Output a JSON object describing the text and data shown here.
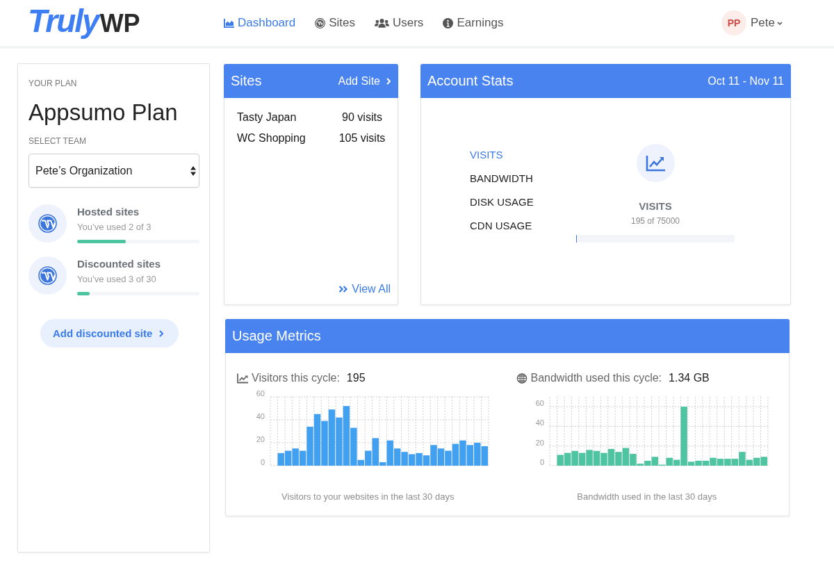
{
  "header": {
    "logo": [
      "Truly",
      "WP"
    ],
    "nav": [
      {
        "label": "Dashboard",
        "selected": true
      },
      {
        "label": "Sites",
        "selected": false
      },
      {
        "label": "Users",
        "selected": false
      },
      {
        "label": "Earnings",
        "selected": false
      }
    ],
    "user": {
      "initials": "PP",
      "name": "Pete"
    }
  },
  "plan_panel": {
    "eyebrow": "YOUR PLAN",
    "plan_name": "Appsumo Plan",
    "team_label": "SELECT TEAM",
    "team_select": {
      "value": "Pete’s Organization"
    },
    "quotas": [
      {
        "title": "Hosted sites",
        "usage": "You’ve used 2 of 3",
        "level": 0.4
      },
      {
        "title": "Discounted sites",
        "usage": "You’ve used 3 of 30",
        "level": 0.1
      }
    ],
    "add_button": "Add discounted site"
  },
  "sites_card": {
    "title": "Sites",
    "action": "Add Site",
    "rows": [
      {
        "name": "Tasty Japan",
        "visits": "90 visits"
      },
      {
        "name": "WC Shopping",
        "visits": "105 visits"
      }
    ],
    "view_all": "View All"
  },
  "account_stats": {
    "title": "Account Stats",
    "period": "Oct 11 - Nov 11",
    "metrics": [
      {
        "label": "VISITS",
        "selected": true
      },
      {
        "label": "BANDWIDTH",
        "selected": false
      },
      {
        "label": "DISK USAGE",
        "selected": false
      },
      {
        "label": "CDN USAGE",
        "selected": false
      }
    ],
    "detail": {
      "title": "VISITS",
      "reading": "195 of 75000",
      "level": 0.003
    }
  },
  "usage_metrics": {
    "title": "Usage Metrics",
    "panels": [
      {
        "label": "Visitors this cycle:",
        "value": "195",
        "chart_data": {
          "type": "bar",
          "grid": true,
          "ylim": [
            0,
            60
          ],
          "yticks": [
            0,
            20,
            40,
            60
          ],
          "series": [
            {
              "color": "#42a0f1",
              "values": [
                0,
                11,
                13,
                15,
                13,
                34,
                45,
                39,
                49,
                42,
                52,
                33,
                5,
                13,
                24,
                3,
                22,
                15,
                12,
                10,
                11,
                9,
                18,
                15,
                13,
                19,
                22,
                18,
                20,
                17
              ]
            }
          ]
        },
        "caption": "Visitors to your websites in the last 30 days"
      },
      {
        "label": "Bandwidth used this cycle:",
        "value": "1.34 GB",
        "chart_data": {
          "type": "bar",
          "grid": true,
          "ylim": [
            0,
            70
          ],
          "yticks": [
            0,
            20,
            40,
            60
          ],
          "series": [
            {
              "color": "#4fc4a0",
              "values": [
                0,
                11,
                13,
                15,
                13,
                16,
                15,
                13,
                17,
                14,
                18,
                12,
                2,
                5,
                9,
                1,
                8,
                6,
                60,
                4,
                5,
                5,
                8,
                7,
                7,
                7,
                14,
                6,
                8,
                9
              ]
            }
          ]
        },
        "caption": "Bandwidth used in the last 30 days"
      }
    ]
  }
}
